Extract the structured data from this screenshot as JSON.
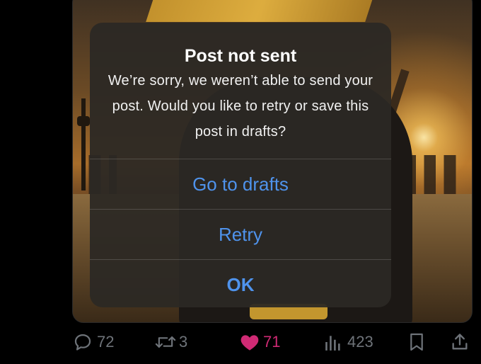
{
  "alert": {
    "title": "Post not sent",
    "message": "We’re sorry, we weren’t able to send your post. Would you like to retry or save this post in drafts?",
    "buttons": {
      "drafts": "Go to drafts",
      "retry": "Retry",
      "ok": "OK"
    }
  },
  "actions": {
    "replies": "72",
    "reposts": "3",
    "likes": "71",
    "views": "423"
  },
  "icons": {
    "reply": "reply-icon",
    "repost": "repost-icon",
    "like": "heart-icon",
    "views": "views-icon",
    "bookmark": "bookmark-icon",
    "share": "share-icon"
  },
  "colors": {
    "accent": "#4f93ec",
    "like": "#cf2a74",
    "muted": "#6e7379"
  }
}
